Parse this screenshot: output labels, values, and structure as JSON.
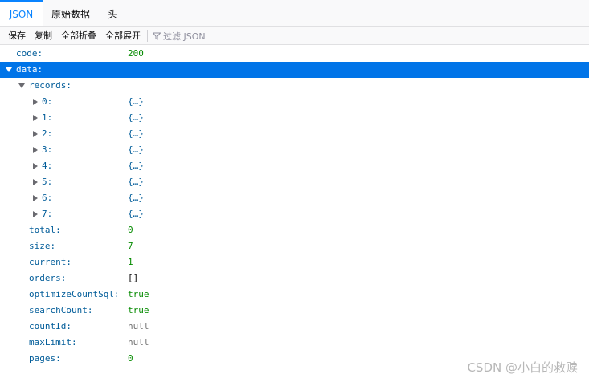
{
  "tabs": {
    "json": "JSON",
    "raw": "原始数据",
    "headers": "头"
  },
  "toolbar": {
    "save": "保存",
    "copy": "复制",
    "collapse_all": "全部折叠",
    "expand_all": "全部展开",
    "filter_placeholder": "过滤 JSON",
    "filter_icon": "funnel-icon"
  },
  "tree": {
    "code": {
      "key": "code:",
      "value": "200"
    },
    "data": {
      "key": "data:"
    },
    "records": {
      "key": "records:"
    },
    "record_items": [
      {
        "key": "0:",
        "value": "{…}"
      },
      {
        "key": "1:",
        "value": "{…}"
      },
      {
        "key": "2:",
        "value": "{…}"
      },
      {
        "key": "3:",
        "value": "{…}"
      },
      {
        "key": "4:",
        "value": "{…}"
      },
      {
        "key": "5:",
        "value": "{…}"
      },
      {
        "key": "6:",
        "value": "{…}"
      },
      {
        "key": "7:",
        "value": "{…}"
      }
    ],
    "total": {
      "key": "total:",
      "value": "0"
    },
    "size": {
      "key": "size:",
      "value": "7"
    },
    "current": {
      "key": "current:",
      "value": "1"
    },
    "orders": {
      "key": "orders:",
      "value": "[]"
    },
    "optimizeCountSql": {
      "key": "optimizeCountSql:",
      "value": "true"
    },
    "searchCount": {
      "key": "searchCount:",
      "value": "true"
    },
    "countId": {
      "key": "countId:",
      "value": "null"
    },
    "maxLimit": {
      "key": "maxLimit:",
      "value": "null"
    },
    "pages": {
      "key": "pages:",
      "value": "0"
    }
  },
  "watermark": "CSDN @小白的救赎",
  "colors": {
    "accent": "#0a84ff",
    "selected_row": "#0074e8",
    "key": "#005c99",
    "number": "#058b00",
    "null": "#737373"
  }
}
